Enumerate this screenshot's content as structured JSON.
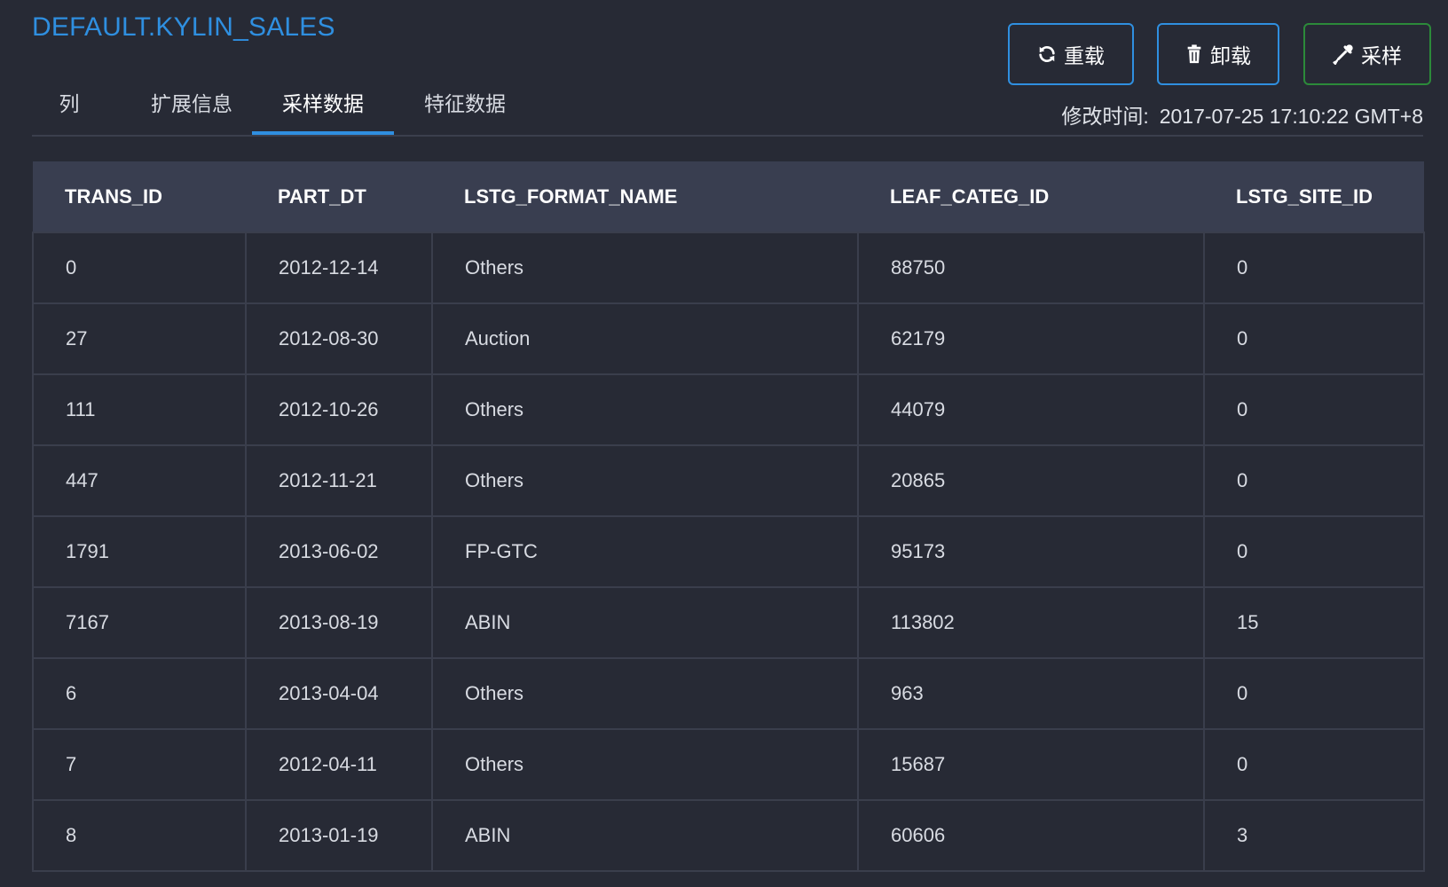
{
  "title": "DEFAULT.KYLIN_SALES",
  "tabs": [
    {
      "label": "列",
      "active": false
    },
    {
      "label": "扩展信息",
      "active": false
    },
    {
      "label": "采样数据",
      "active": true
    },
    {
      "label": "特征数据",
      "active": false
    }
  ],
  "toolbar": {
    "reload_label": "重载",
    "reload_icon": "refresh-icon",
    "unload_label": "卸载",
    "unload_icon": "trash-icon",
    "sample_label": "采样",
    "sample_icon": "eyedropper-icon"
  },
  "modified": {
    "label": "修改时间:",
    "value": "2017-07-25 17:10:22 GMT+8"
  },
  "colors": {
    "accent": "#2f8fe0",
    "sample_button_border": "#2c8a3a",
    "background": "#272a35",
    "header_bg": "#393e50"
  },
  "table": {
    "columns": [
      "TRANS_ID",
      "PART_DT",
      "LSTG_FORMAT_NAME",
      "LEAF_CATEG_ID",
      "LSTG_SITE_ID"
    ],
    "rows": [
      [
        "0",
        "2012-12-14",
        "Others",
        "88750",
        "0"
      ],
      [
        "27",
        "2012-08-30",
        "Auction",
        "62179",
        "0"
      ],
      [
        "111",
        "2012-10-26",
        "Others",
        "44079",
        "0"
      ],
      [
        "447",
        "2012-11-21",
        "Others",
        "20865",
        "0"
      ],
      [
        "1791",
        "2013-06-02",
        "FP-GTC",
        "95173",
        "0"
      ],
      [
        "7167",
        "2013-08-19",
        "ABIN",
        "113802",
        "15"
      ],
      [
        "6",
        "2013-04-04",
        "Others",
        "963",
        "0"
      ],
      [
        "7",
        "2012-04-11",
        "Others",
        "15687",
        "0"
      ],
      [
        "8",
        "2013-01-19",
        "ABIN",
        "60606",
        "3"
      ]
    ]
  }
}
